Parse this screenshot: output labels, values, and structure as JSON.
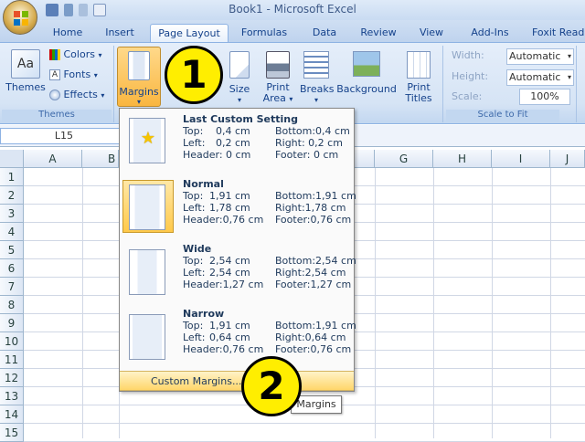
{
  "window": {
    "title": "Book1 - Microsoft Excel"
  },
  "tabs": [
    "Home",
    "Insert",
    "Page Layout",
    "Formulas",
    "Data",
    "Review",
    "View",
    "Add-Ins",
    "Foxit Reade"
  ],
  "ribbon": {
    "themes_group": {
      "label": "Themes",
      "themes_btn": "Themes",
      "colors": "Colors",
      "fonts": "Fonts",
      "effects": "Effects"
    },
    "margins_btn": "Margins",
    "size_btn": "Size",
    "print_area_btn": [
      "Print",
      "Area"
    ],
    "breaks_btn": "Breaks",
    "background_btn": "Background",
    "print_titles_btn": [
      "Print",
      "Titles"
    ],
    "scale_group": {
      "label": "Scale to Fit",
      "width_label": "Width:",
      "width_value": "Automatic",
      "height_label": "Height:",
      "height_value": "Automatic",
      "scale_label": "Scale:",
      "scale_value": "100%"
    }
  },
  "namebox": "L15",
  "columns": [
    "A",
    "B",
    "G",
    "H",
    "I",
    "J"
  ],
  "rows": [
    "1",
    "2",
    "3",
    "4",
    "5",
    "6",
    "7",
    "8",
    "9",
    "10",
    "11",
    "12",
    "13",
    "14",
    "15"
  ],
  "margins_menu": {
    "items": [
      {
        "title": "Last Custom Setting",
        "rows": [
          [
            "Top:",
            "0,4 cm",
            "Bottom:0,4 cm"
          ],
          [
            "Left:",
            "0,2 cm",
            "Right:  0,2 cm"
          ],
          [
            "Header: 0 cm",
            "",
            "Footer:  0 cm"
          ]
        ]
      },
      {
        "title": "Normal",
        "rows": [
          [
            "Top:",
            "1,91 cm",
            "Bottom:1,91 cm"
          ],
          [
            "Left:",
            "1,78 cm",
            "Right:1,78 cm"
          ],
          [
            "Header:0,76 cm",
            "",
            "Footer:0,76 cm"
          ]
        ]
      },
      {
        "title": "Wide",
        "rows": [
          [
            "Top:",
            "2,54 cm",
            "Bottom:2,54 cm"
          ],
          [
            "Left:",
            "2,54 cm",
            "Right:2,54 cm"
          ],
          [
            "Header:1,27 cm",
            "",
            "Footer:1,27 cm"
          ]
        ]
      },
      {
        "title": "Narrow",
        "rows": [
          [
            "Top:",
            "1,91 cm",
            "Bottom:1,91 cm"
          ],
          [
            "Left:",
            "0,64 cm",
            "Right:0,64 cm"
          ],
          [
            "Header:0,76 cm",
            "",
            "Footer:0,76 cm"
          ]
        ]
      }
    ],
    "custom": "Custom Margins...",
    "tooltip": "Margins"
  },
  "callouts": [
    "1",
    "2"
  ]
}
